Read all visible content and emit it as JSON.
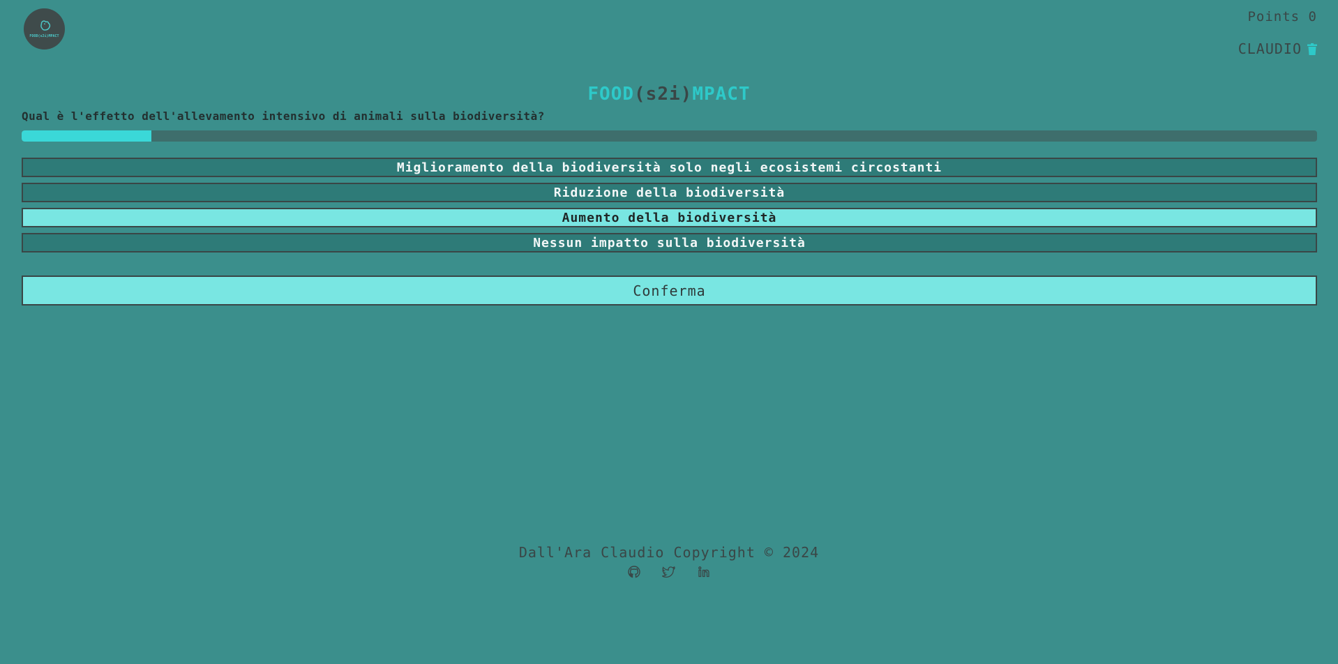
{
  "header": {
    "logo_text": "FOOD(s2i)MPACT",
    "points_label": "Points",
    "points_value": "0",
    "username": "CLAUDIO"
  },
  "title": {
    "part1": "FOOD",
    "part2": "(s2i)",
    "part3": "MPACT"
  },
  "quiz": {
    "question": "Qual è l'effetto dell'allevamento intensivo di animali sulla biodiversità?",
    "progress_fraction": 0.1,
    "options": [
      {
        "label": "Miglioramento della biodiversità solo negli ecosistemi circostanti",
        "selected": false
      },
      {
        "label": "Riduzione della biodiversità",
        "selected": false
      },
      {
        "label": "Aumento della biodiversità",
        "selected": true
      },
      {
        "label": "Nessun impatto sulla biodiversità",
        "selected": false
      }
    ],
    "confirm_label": "Conferma"
  },
  "footer": {
    "copyright": "Dall'Ara Claudio Copyright © 2024",
    "social_icons": [
      "github-icon",
      "twitter-icon",
      "linkedin-icon"
    ]
  },
  "colors": {
    "background": "#3b8f8c",
    "accent": "#2ec9c9",
    "option_bg": "#2e7b78",
    "option_selected_bg": "#79e6e2",
    "dark_text": "#3a4646"
  }
}
